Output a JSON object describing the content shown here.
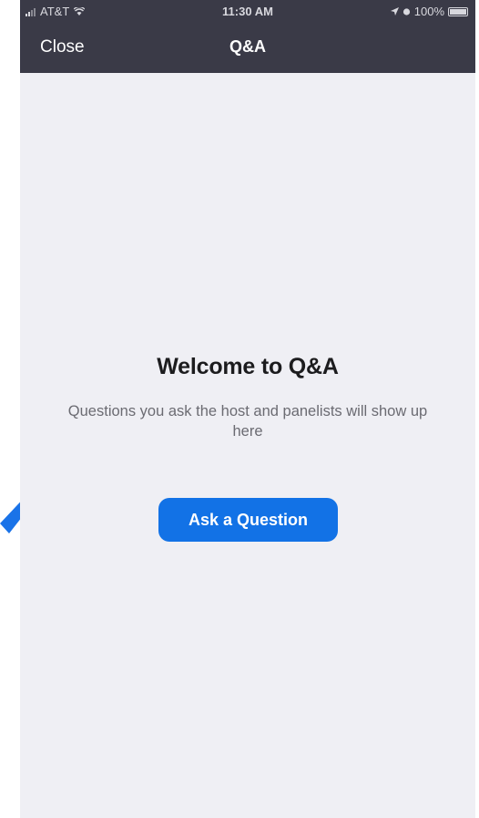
{
  "status_bar": {
    "carrier": "AT&T",
    "time": "11:30 AM",
    "battery": "100%"
  },
  "nav": {
    "close_label": "Close",
    "title": "Q&A"
  },
  "empty_state": {
    "title": "Welcome to Q&A",
    "description": "Questions you ask the host and panelists will show up here",
    "button_label": "Ask a Question"
  },
  "colors": {
    "nav_background": "#3a3a47",
    "content_background": "#efeff4",
    "button_blue": "#1272e6",
    "pointer_arrow": "#1a73e8"
  },
  "icons": [
    "signal-icon",
    "wifi-icon",
    "location-arrow-icon",
    "alarm-icon",
    "battery-icon",
    "pointer-arrow"
  ]
}
